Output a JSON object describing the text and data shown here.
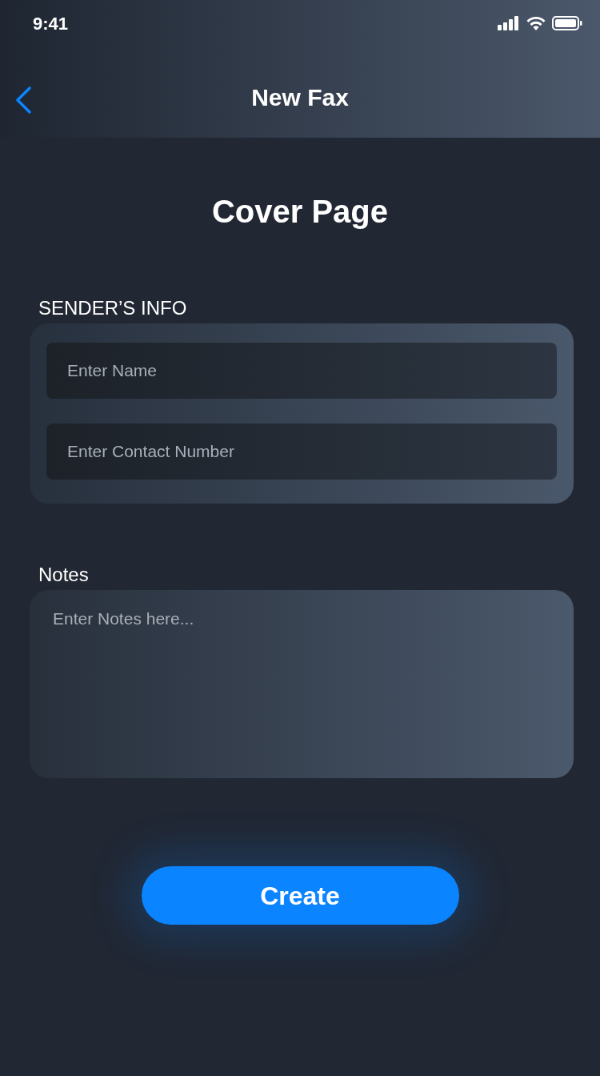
{
  "status_bar": {
    "time": "9:41"
  },
  "header": {
    "title": "New Fax"
  },
  "page_title": "Cover Page",
  "sender_section": {
    "label": "SENDER’S INFO",
    "fields": [
      {
        "placeholder": "Enter Name"
      },
      {
        "placeholder": "Enter Contact Number"
      }
    ]
  },
  "notes_section": {
    "label": "Notes",
    "placeholder": "Enter Notes here..."
  },
  "create_button": {
    "label": "Create"
  }
}
